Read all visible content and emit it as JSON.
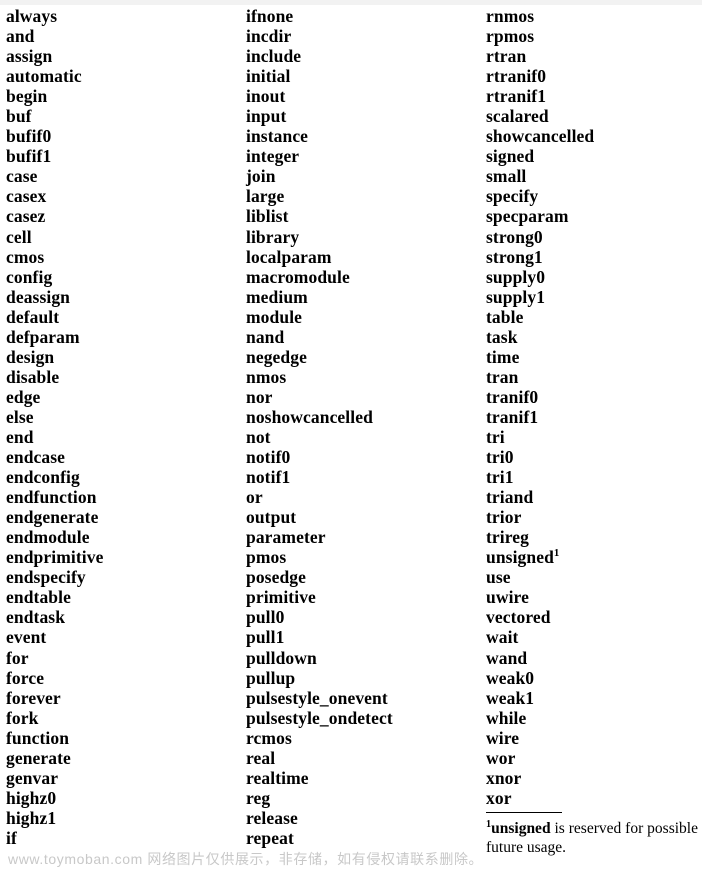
{
  "page": {
    "kind": "verilog-keyword-reference-table",
    "background_color": "#ffffff",
    "text_color": "#000000"
  },
  "columns": [
    {
      "id": "column-1",
      "items": [
        {
          "text": "always"
        },
        {
          "text": "and"
        },
        {
          "text": "assign"
        },
        {
          "text": "automatic"
        },
        {
          "text": "begin"
        },
        {
          "text": "buf"
        },
        {
          "text": "bufif0"
        },
        {
          "text": "bufif1"
        },
        {
          "text": "case"
        },
        {
          "text": "casex"
        },
        {
          "text": "casez"
        },
        {
          "text": "cell"
        },
        {
          "text": "cmos"
        },
        {
          "text": "config"
        },
        {
          "text": "deassign"
        },
        {
          "text": "default"
        },
        {
          "text": "defparam"
        },
        {
          "text": "design"
        },
        {
          "text": "disable"
        },
        {
          "text": "edge"
        },
        {
          "text": "else"
        },
        {
          "text": "end"
        },
        {
          "text": "endcase"
        },
        {
          "text": "endconfig"
        },
        {
          "text": "endfunction"
        },
        {
          "text": "endgenerate"
        },
        {
          "text": "endmodule"
        },
        {
          "text": "endprimitive"
        },
        {
          "text": "endspecify"
        },
        {
          "text": "endtable"
        },
        {
          "text": "endtask"
        },
        {
          "text": "event"
        },
        {
          "text": "for"
        },
        {
          "text": "force"
        },
        {
          "text": "forever"
        },
        {
          "text": "fork"
        },
        {
          "text": "function"
        },
        {
          "text": "generate"
        },
        {
          "text": "genvar"
        },
        {
          "text": "highz0"
        },
        {
          "text": "highz1"
        },
        {
          "text": "if"
        }
      ]
    },
    {
      "id": "column-2",
      "items": [
        {
          "text": "ifnone"
        },
        {
          "text": "incdir"
        },
        {
          "text": "include"
        },
        {
          "text": "initial"
        },
        {
          "text": "inout"
        },
        {
          "text": "input"
        },
        {
          "text": "instance"
        },
        {
          "text": "integer"
        },
        {
          "text": "join"
        },
        {
          "text": "large"
        },
        {
          "text": "liblist"
        },
        {
          "text": "library"
        },
        {
          "text": "localparam"
        },
        {
          "text": "macromodule"
        },
        {
          "text": "medium"
        },
        {
          "text": "module"
        },
        {
          "text": "nand"
        },
        {
          "text": "negedge"
        },
        {
          "text": "nmos"
        },
        {
          "text": "nor"
        },
        {
          "text": "noshowcancelled"
        },
        {
          "text": "not"
        },
        {
          "text": "notif0"
        },
        {
          "text": "notif1"
        },
        {
          "text": "or"
        },
        {
          "text": "output"
        },
        {
          "text": "parameter"
        },
        {
          "text": "pmos"
        },
        {
          "text": "posedge"
        },
        {
          "text": "primitive"
        },
        {
          "text": "pull0"
        },
        {
          "text": "pull1"
        },
        {
          "text": "pulldown"
        },
        {
          "text": "pullup"
        },
        {
          "text": "pulsestyle_onevent"
        },
        {
          "text": "pulsestyle_ondetect"
        },
        {
          "text": "rcmos"
        },
        {
          "text": "real"
        },
        {
          "text": "realtime"
        },
        {
          "text": "reg"
        },
        {
          "text": "release"
        },
        {
          "text": "repeat"
        }
      ]
    },
    {
      "id": "column-3",
      "items": [
        {
          "text": "rnmos"
        },
        {
          "text": "rpmos"
        },
        {
          "text": "rtran"
        },
        {
          "text": "rtranif0"
        },
        {
          "text": "rtranif1"
        },
        {
          "text": "scalared"
        },
        {
          "text": "showcancelled"
        },
        {
          "text": "signed"
        },
        {
          "text": "small"
        },
        {
          "text": "specify"
        },
        {
          "text": "specparam"
        },
        {
          "text": "strong0"
        },
        {
          "text": "strong1"
        },
        {
          "text": "supply0"
        },
        {
          "text": "supply1"
        },
        {
          "text": "table"
        },
        {
          "text": "task"
        },
        {
          "text": "time"
        },
        {
          "text": "tran"
        },
        {
          "text": "tranif0"
        },
        {
          "text": "tranif1"
        },
        {
          "text": "tri"
        },
        {
          "text": "tri0"
        },
        {
          "text": "tri1"
        },
        {
          "text": "triand"
        },
        {
          "text": "trior"
        },
        {
          "text": "trireg"
        },
        {
          "text": "unsigned",
          "footnote_marker": "1"
        },
        {
          "text": "use"
        },
        {
          "text": "uwire"
        },
        {
          "text": "vectored"
        },
        {
          "text": "wait"
        },
        {
          "text": "wand"
        },
        {
          "text": "weak0"
        },
        {
          "text": "weak1"
        },
        {
          "text": "while"
        },
        {
          "text": "wire"
        },
        {
          "text": "wor"
        },
        {
          "text": "xnor"
        },
        {
          "text": "xor"
        }
      ]
    }
  ],
  "footnote": {
    "marker": "1",
    "bold_term": "unsigned",
    "text": " is reserved for possible future usage."
  },
  "watermark": {
    "text": "www.toymoban.com 网络图片仅供展示，非存储，如有侵权请联系删除。",
    "color": "#c8c8c8"
  }
}
